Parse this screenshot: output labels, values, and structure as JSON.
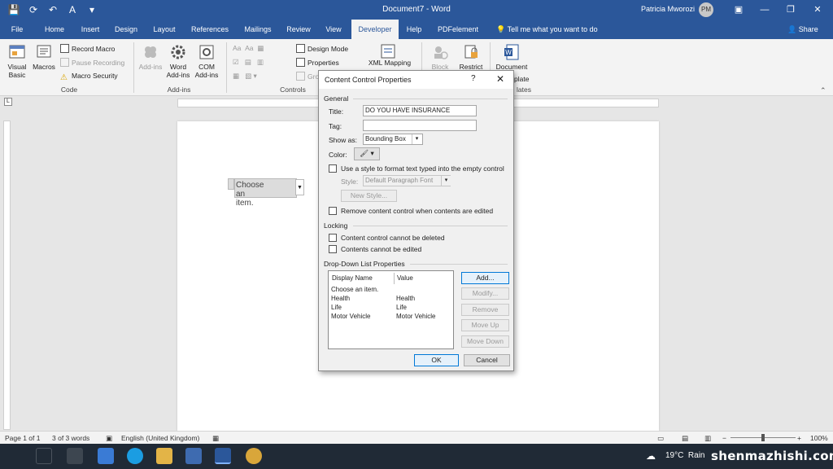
{
  "titlebar": {
    "title": "Document7 - Word",
    "user_name": "Patricia Mworozi",
    "user_initials": "PM"
  },
  "tabs": [
    "File",
    "Home",
    "Insert",
    "Design",
    "Layout",
    "References",
    "Mailings",
    "Review",
    "View",
    "Developer",
    "Help",
    "PDFelement"
  ],
  "active_tab": "Developer",
  "tell_me": "Tell me what you want to do",
  "share": "Share",
  "ribbon": {
    "code": {
      "visual_basic": "Visual Basic",
      "macros": "Macros",
      "record_macro": "Record Macro",
      "pause_recording": "Pause Recording",
      "macro_security": "Macro Security",
      "label": "Code"
    },
    "addins": {
      "addins": "Add-ins",
      "word_addins": "Word Add-ins",
      "com_addins": "COM Add-ins",
      "label": "Add-ins"
    },
    "controls": {
      "design_mode": "Design Mode",
      "properties": "Properties",
      "group": "Gro",
      "label": "Controls"
    },
    "mapping": "XML Mapping",
    "protect": {
      "block": "Block",
      "restrict": "Restrict"
    },
    "templates": {
      "document": "Document",
      "template_label": "plate",
      "group_label": "lates"
    }
  },
  "document": {
    "content_control_text": "Choose an item."
  },
  "dialog": {
    "title": "Content Control Properties",
    "help": "?",
    "close": "✕",
    "general_label": "General",
    "title_label": "Title:",
    "title_value": "DO YOU HAVE INSURANCE",
    "tag_label": "Tag:",
    "tag_value": "",
    "show_as_label": "Show as:",
    "show_as_value": "Bounding Box",
    "color_label": "Color:",
    "use_style_label": "Use a style to format text typed into the empty control",
    "style_label": "Style:",
    "style_value": "Default Paragraph Font",
    "new_style": "New Style...",
    "remove_cc_label": "Remove content control when contents are edited",
    "locking_label": "Locking",
    "cannot_delete_label": "Content control cannot be deleted",
    "cannot_edit_label": "Contents cannot be edited",
    "dropdown_label": "Drop-Down List Properties",
    "col_display": "Display Name",
    "col_value": "Value",
    "items": [
      {
        "display": "Choose an item.",
        "value": ""
      },
      {
        "display": "Health",
        "value": "Health"
      },
      {
        "display": "Life",
        "value": "Life"
      },
      {
        "display": "Motor Vehicle",
        "value": "Motor Vehicle"
      }
    ],
    "add": "Add...",
    "modify": "Modify...",
    "remove": "Remove",
    "move_up": "Move Up",
    "move_down": "Move Down",
    "ok": "OK",
    "cancel": "Cancel"
  },
  "statusbar": {
    "page": "Page 1 of 1",
    "words": "3 of 3 words",
    "language": "English (United Kingdom)",
    "zoom": "100%"
  },
  "taskbar": {
    "temperature": "19°C",
    "weather": "Rain",
    "watermark": "shenmazhishi.com"
  },
  "colors": {
    "word_blue": "#2b579a",
    "ribbon_bg": "#f3f3f3",
    "taskbar_bg": "#202a36"
  }
}
